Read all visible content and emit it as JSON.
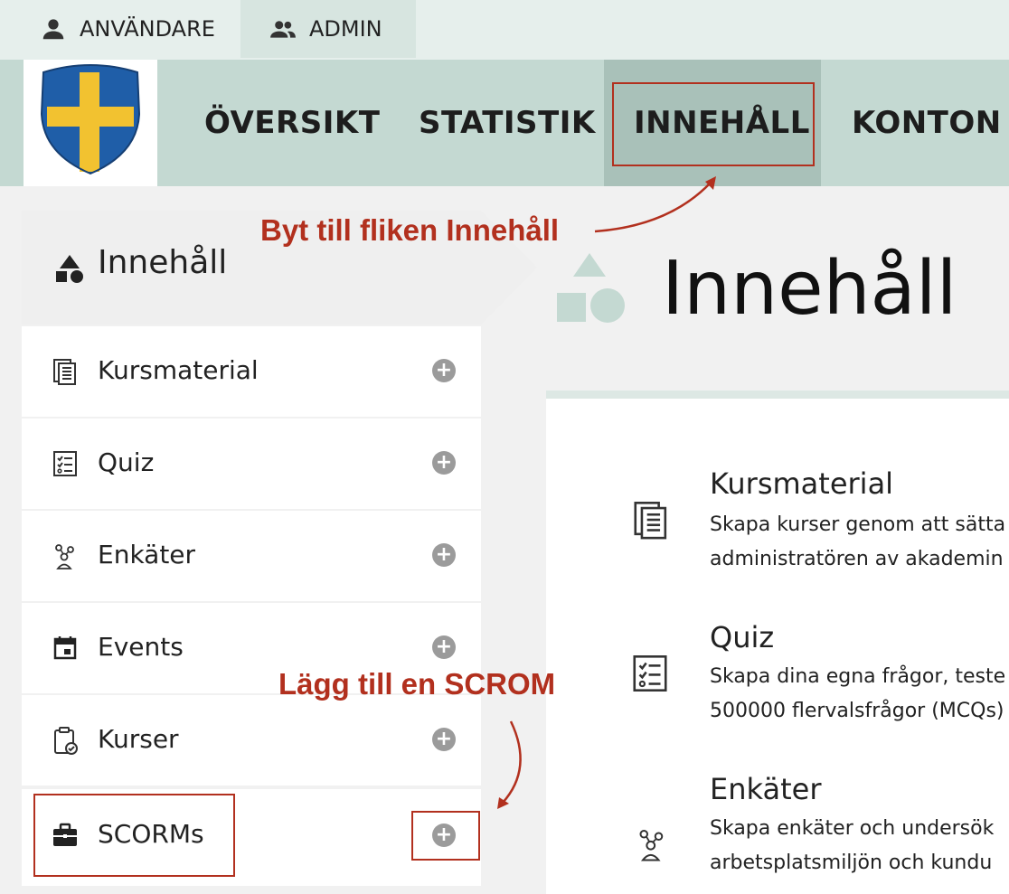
{
  "topbar": {
    "user_label": "ANVÄNDARE",
    "admin_label": "ADMIN"
  },
  "nav": {
    "items": [
      {
        "label": "ÖVERSIKT"
      },
      {
        "label": "STATISTIK"
      },
      {
        "label": "INNEHÅLL",
        "active": true
      },
      {
        "label": "KONTON"
      }
    ]
  },
  "sidebar": {
    "header_label": "Innehåll",
    "items": [
      {
        "label": "Kursmaterial",
        "icon": "document-icon"
      },
      {
        "label": "Quiz",
        "icon": "checklist-icon"
      },
      {
        "label": "Enkäter",
        "icon": "survey-icon"
      },
      {
        "label": "Events",
        "icon": "calendar-icon"
      },
      {
        "label": "Kurser",
        "icon": "clipboard-check-icon"
      },
      {
        "label": "SCORMs",
        "icon": "briefcase-icon"
      }
    ],
    "add_symbol": "+"
  },
  "main": {
    "title": "Innehåll",
    "entries": [
      {
        "title": "Kursmaterial",
        "line1": "Skapa kurser genom att sätta",
        "line2": "administratören av akademin"
      },
      {
        "title": "Quiz",
        "line1": "Skapa dina egna frågor, teste",
        "line2": "500000 flervalsfrågor (MCQs)"
      },
      {
        "title": "Enkäter",
        "line1": "Skapa enkäter och undersök",
        "line2": "arbetsplatsmiljön och kundu"
      }
    ]
  },
  "annotations": {
    "switch_tab": "Byt till fliken Innehåll",
    "add_scorm": "Lägg till en SCROM"
  },
  "colors": {
    "nav_bg": "#c4d9d2",
    "nav_active": "#a9c1b9",
    "annotation": "#b2301e",
    "shield_blue": "#1f5ea8",
    "shield_yellow": "#f2c230"
  }
}
